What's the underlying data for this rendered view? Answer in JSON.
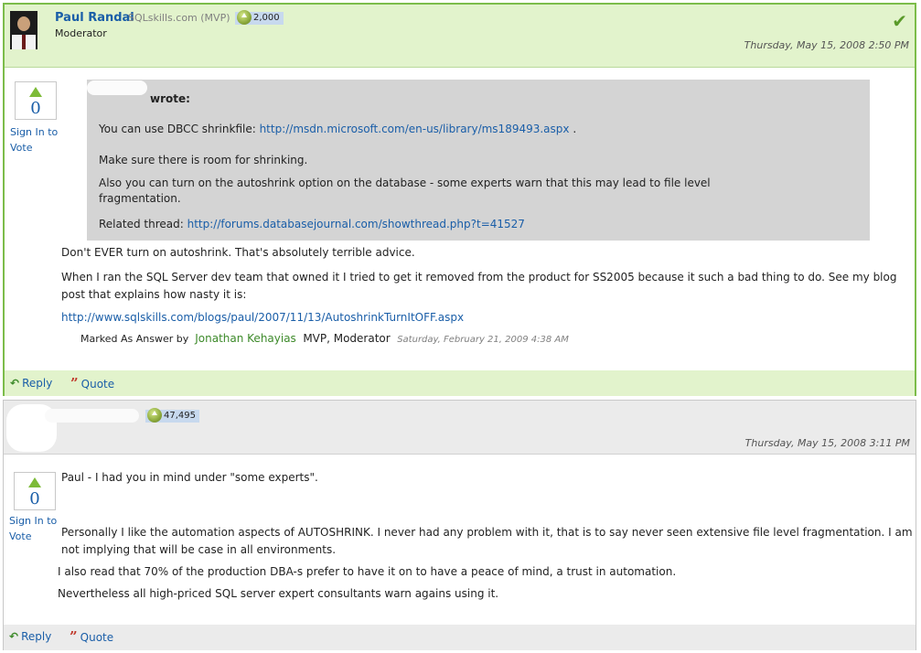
{
  "post1": {
    "author_name": "Paul Randal",
    "author_affiliation": "SQLskills.com",
    "author_status": "(MVP)",
    "points": "2,000",
    "role": "Moderator",
    "date": "Thursday, May 15, 2008 2:50 PM",
    "vote_count": "0",
    "signin_line1": "Sign In to",
    "signin_line2": "Vote",
    "quote": {
      "wrote": "wrote:",
      "line1_text": "You can use DBCC shrinkfile: ",
      "line1_link": "http://msdn.microsoft.com/en-us/library/ms189493.aspx",
      "line1_end": " .",
      "line2": "Make sure there is room for shrinking.",
      "line3a": "Also you can turn on the autoshrink option on the database - some experts warn that this may lead to file level",
      "line3b": "fragmentation.",
      "line4_text": "Related thread: ",
      "line4_link": "http://forums.databasejournal.com/showthread.php?t=41527"
    },
    "body1": "Don't EVER turn on autoshrink. That's absolutely terrible advice.",
    "body2a": "When I ran the SQL Server dev team that owned it I tried to get it removed from the product for SS2005 because it such a bad thing to do. See my blog",
    "body2b": "post that explains how nasty it is:",
    "blog_link": "http://www.sqlskills.com/blogs/paul/2007/11/13/AutoshrinkTurnItOFF.aspx",
    "marked_label": "Marked As Answer by",
    "marked_by": "Jonathan Kehayias",
    "marked_role": "MVP, Moderator",
    "marked_date": "Saturday, February 21, 2009 4:38 AM",
    "reply_label": "Reply",
    "quote_label": "Quote"
  },
  "post2": {
    "points": "47,495",
    "date": "Thursday, May 15, 2008 3:11 PM",
    "vote_count": "0",
    "signin_line1": "Sign In to",
    "signin_line2": "Vote",
    "p1": "Paul - I had you in mind under \"some experts\".",
    "p2a": "Personally I like the automation aspects of AUTOSHRINK. I never had any problem with it, that is to say never seen extensive file level fragmentation.  I am",
    "p2b": "not implying that will be case in all environments.",
    "p3": "I also read that 70% of the production DBA-s prefer to have it on to have a peace of mind, a trust in automation.",
    "p4": "Nevertheless all high-priced SQL server expert consultants warn agains using it.",
    "reply_label": "Reply",
    "quote_label": "Quote"
  },
  "colors": {
    "accent_green": "#7cbc4a",
    "header_green": "#e2f3cc",
    "link_blue": "#1a5ea8",
    "quote_gray": "#d4d4d4"
  },
  "icons": [
    "checkmark-icon",
    "vote-up-arrow-icon",
    "points-up-icon",
    "reply-arrow-icon",
    "quote-marks-icon"
  ]
}
